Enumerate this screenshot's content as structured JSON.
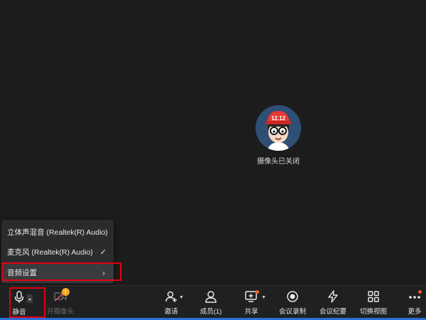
{
  "participant": {
    "avatar_badge_text": "12.12",
    "camera_status": "摄像头已关闭"
  },
  "audio_menu": {
    "items": [
      {
        "label": "立体声混音 (Realtek(R) Audio)",
        "checked": false
      },
      {
        "label": "麦克风 (Realtek(R) Audio)",
        "checked": true,
        "check_glyph": "✓"
      },
      {
        "label": "音频设置",
        "submenu_glyph": "›"
      }
    ]
  },
  "toolbar": {
    "mute_label": "静音",
    "camera_label": "开摄像头",
    "camera_warning": "!",
    "invite_label": "邀请",
    "members_label": "成员(1)",
    "share_label": "共享",
    "record_label": "会议录制",
    "minutes_label": "会议纪要",
    "switch_view_label": "切换视图",
    "more_label": "更多"
  },
  "colors": {
    "highlight": "#e0000f",
    "accent_bottom": "#2b6fd6",
    "badge_orange": "#f5a623",
    "notify_dot": "#f15a24"
  }
}
